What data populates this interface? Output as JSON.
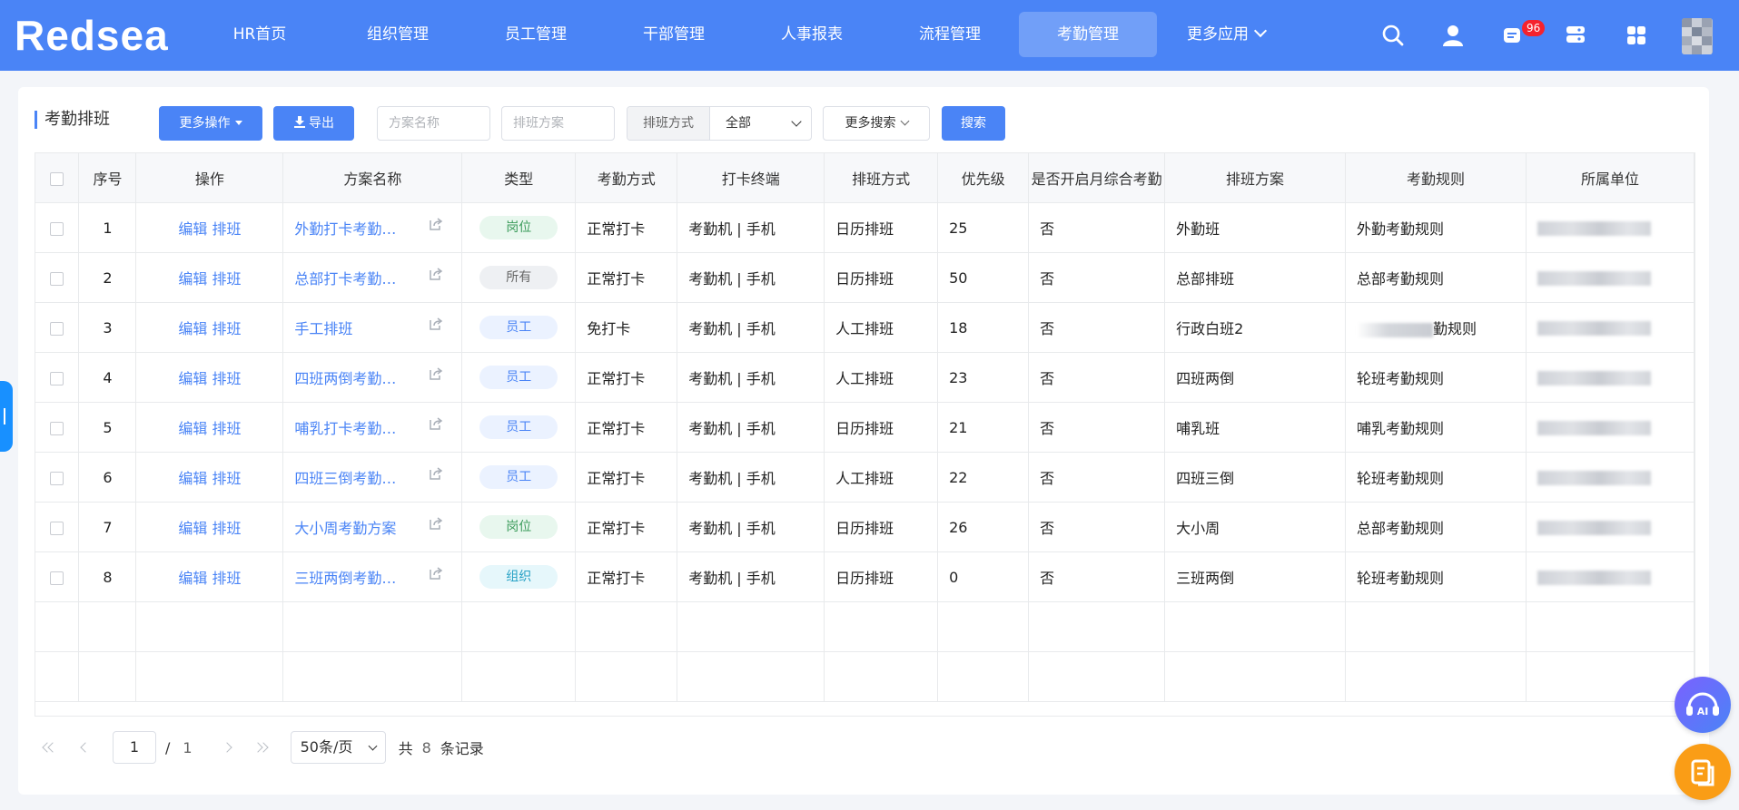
{
  "header": {
    "logo": "Redsea",
    "nav": [
      {
        "label": "HR首页"
      },
      {
        "label": "组织管理"
      },
      {
        "label": "员工管理"
      },
      {
        "label": "干部管理"
      },
      {
        "label": "人事报表"
      },
      {
        "label": "流程管理"
      },
      {
        "label": "考勤管理",
        "active": true
      },
      {
        "label": "更多应用"
      }
    ],
    "icons": [
      "search-icon",
      "user-icon",
      "message-icon",
      "server-icon",
      "apps-grid-icon"
    ],
    "message_badge": "96"
  },
  "toolbar": {
    "page_title": "考勤排班",
    "more_actions": "更多操作",
    "export": "导出",
    "plan_name_placeholder": "方案名称",
    "schedule_plan_placeholder": "排班方案",
    "sort_label": "排班方式",
    "sort_value": "全部",
    "more_search": "更多搜索",
    "search": "搜索"
  },
  "table": {
    "columns": [
      "序号",
      "操作",
      "方案名称",
      "类型",
      "考勤方式",
      "打卡终端",
      "排班方式",
      "优先级",
      "是否开启月综合考勤",
      "排班方案",
      "考勤规则",
      "所属单位"
    ],
    "edit_label": "编辑",
    "schedule_label": "排班",
    "rows": [
      {
        "no": "1",
        "name": "外勤打卡考勤方案",
        "type": "岗位",
        "method": "正常打卡",
        "terminal": "考勤机 | 手机",
        "sched": "日历排班",
        "priority": "25",
        "monthly": "否",
        "plan": "外勤班",
        "rule": "外勤考勤规则"
      },
      {
        "no": "2",
        "name": "总部打卡考勤方案",
        "type": "所有",
        "method": "正常打卡",
        "terminal": "考勤机 | 手机",
        "sched": "日历排班",
        "priority": "50",
        "monthly": "否",
        "plan": "总部排班",
        "rule": "总部考勤规则"
      },
      {
        "no": "3",
        "name": "手工排班",
        "type": "员工",
        "method": "免打卡",
        "terminal": "考勤机 | 手机",
        "sched": "人工排班",
        "priority": "18",
        "monthly": "否",
        "plan": "行政白班2",
        "rule": "勤规则"
      },
      {
        "no": "4",
        "name": "四班两倒考勤方案",
        "type": "员工",
        "method": "正常打卡",
        "terminal": "考勤机 | 手机",
        "sched": "人工排班",
        "priority": "23",
        "monthly": "否",
        "plan": "四班两倒",
        "rule": "轮班考勤规则"
      },
      {
        "no": "5",
        "name": "哺乳打卡考勤方案",
        "type": "员工",
        "method": "正常打卡",
        "terminal": "考勤机 | 手机",
        "sched": "日历排班",
        "priority": "21",
        "monthly": "否",
        "plan": "哺乳班",
        "rule": "哺乳考勤规则"
      },
      {
        "no": "6",
        "name": "四班三倒考勤方案",
        "type": "员工",
        "method": "正常打卡",
        "terminal": "考勤机 | 手机",
        "sched": "人工排班",
        "priority": "22",
        "monthly": "否",
        "plan": "四班三倒",
        "rule": "轮班考勤规则"
      },
      {
        "no": "7",
        "name": "大小周考勤方案",
        "type": "岗位",
        "method": "正常打卡",
        "terminal": "考勤机 | 手机",
        "sched": "日历排班",
        "priority": "26",
        "monthly": "否",
        "plan": "大小周",
        "rule": "总部考勤规则"
      },
      {
        "no": "8",
        "name": "三班两倒考勤方案",
        "type": "组织",
        "method": "正常打卡",
        "terminal": "考勤机 | 手机",
        "sched": "日历排班",
        "priority": "0",
        "monthly": "否",
        "plan": "三班两倒",
        "rule": "轮班考勤规则"
      }
    ]
  },
  "pagination": {
    "current": "1",
    "separator": "/",
    "total_pages": "1",
    "page_size": "50条/页",
    "total_prefix": "共",
    "total_count": "8",
    "total_suffix": "条记录"
  },
  "colors": {
    "brand": "#4a84f6",
    "ai_button": "#7b61ff",
    "note_button": "#fa9d16"
  }
}
